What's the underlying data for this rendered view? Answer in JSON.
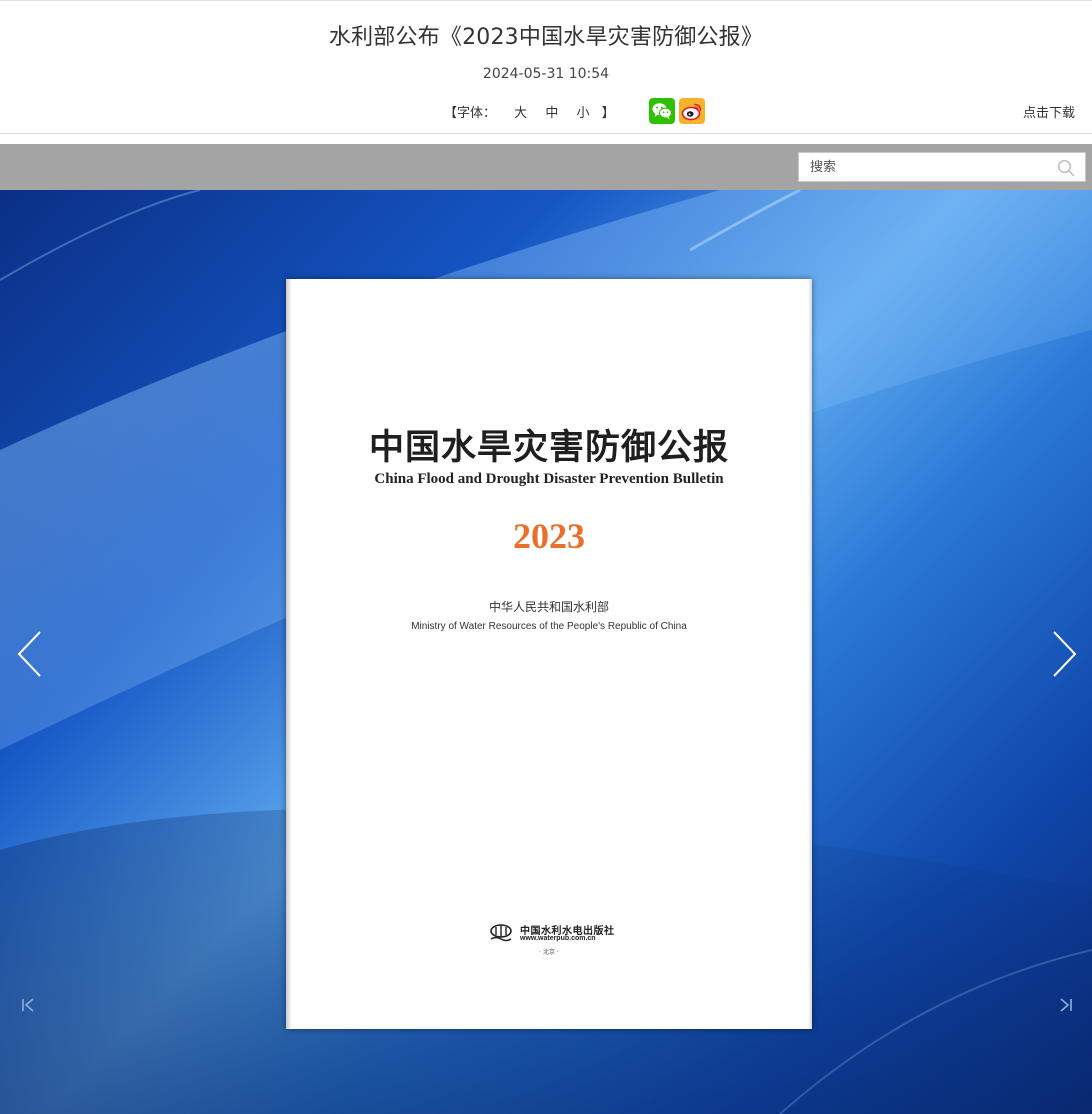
{
  "article": {
    "title": "水利部公布《2023中国水旱灾害防御公报》",
    "date": "2024-05-31 10:54",
    "font_size": {
      "open": "【字体：",
      "options": [
        "大",
        "中",
        "小"
      ],
      "close": "】"
    },
    "share": [
      "wechat-icon",
      "weibo-icon"
    ],
    "download_label": "点击下载"
  },
  "toolbar": {
    "search": {
      "placeholder": "搜索",
      "value": ""
    }
  },
  "cover": {
    "title_cn": "中国水旱灾害防御公报",
    "title_en": "China Flood and Drought Disaster Prevention Bulletin",
    "year": "2023",
    "ministry_cn": "中华人民共和国水利部",
    "ministry_en": "Ministry of Water Resources of the People's Republic of China",
    "publisher_cn": "中国水利水电出版社",
    "publisher_url": "www.waterpub.com.cn",
    "publisher_city": "· 北京 ·"
  },
  "colors": {
    "toolbar_bg": "#a4a4a4",
    "year_accent": "#e8702a",
    "wechat_green": "#2dc100",
    "weibo_yellow": "#f7b32b"
  }
}
